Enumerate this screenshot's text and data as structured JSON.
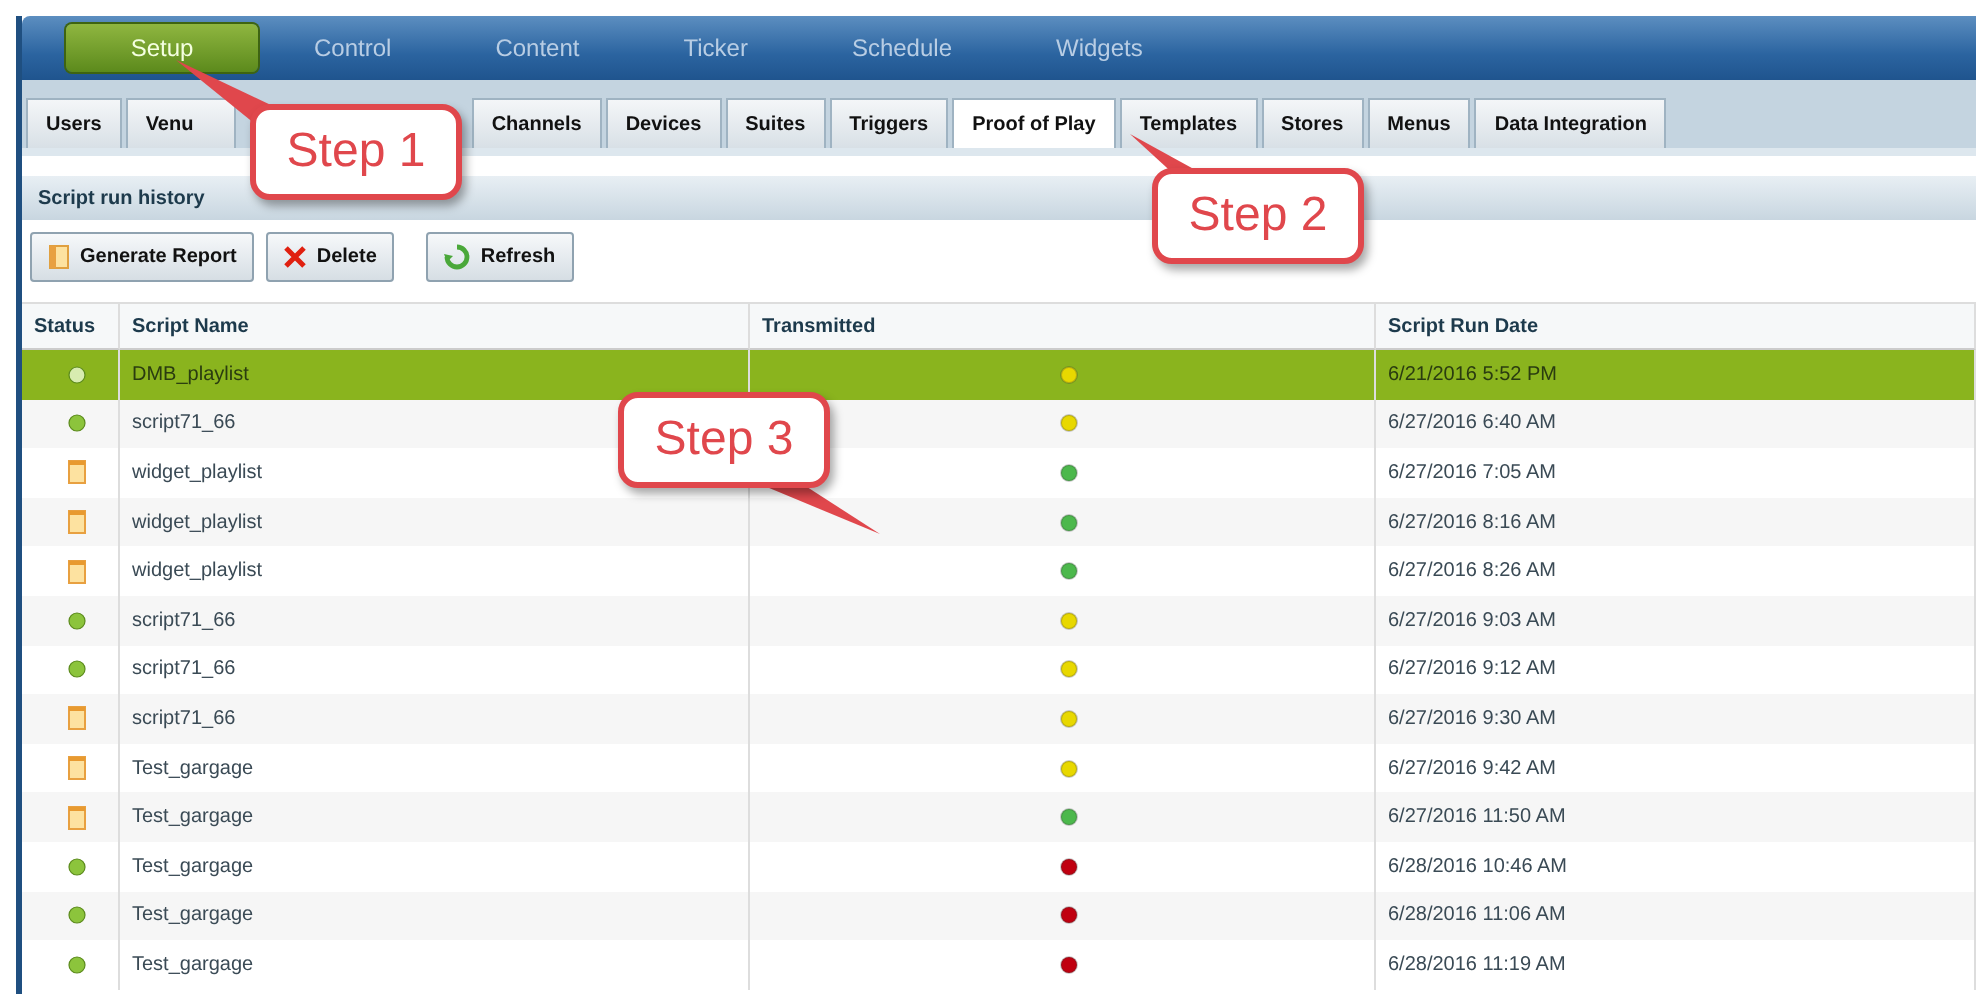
{
  "nav": [
    {
      "label": "Setup",
      "selected": true
    },
    {
      "label": "Control",
      "selected": false
    },
    {
      "label": "Content",
      "selected": false
    },
    {
      "label": "Ticker",
      "selected": false
    },
    {
      "label": "Schedule",
      "selected": false
    },
    {
      "label": "Widgets",
      "selected": false
    }
  ],
  "tabs": [
    {
      "label": "Users",
      "selected": false
    },
    {
      "label": "Venu",
      "selected": false
    },
    {
      "label": "Channels",
      "selected": false
    },
    {
      "label": "Devices",
      "selected": false
    },
    {
      "label": "Suites",
      "selected": false
    },
    {
      "label": "Triggers",
      "selected": false
    },
    {
      "label": "Proof of Play",
      "selected": true
    },
    {
      "label": "Templates",
      "selected": false
    },
    {
      "label": "Stores",
      "selected": false
    },
    {
      "label": "Menus",
      "selected": false
    },
    {
      "label": "Data Integration",
      "selected": false
    }
  ],
  "section_title": "Script run history",
  "toolbar": [
    {
      "label": "Generate Report",
      "kind": "report"
    },
    {
      "label": "Delete",
      "kind": "delete"
    },
    {
      "label": "Refresh",
      "kind": "refresh"
    }
  ],
  "table": {
    "columns": [
      "Status",
      "Script Name",
      "Transmitted",
      "Script Run Date"
    ],
    "rows": [
      {
        "kind": "dot",
        "name": "DMB_playlist",
        "transmitted": {
          "color": "#e8d800"
        },
        "date": "6/21/2016 5:52 PM",
        "selected": true
      },
      {
        "kind": "dot",
        "name": "script71_66",
        "transmitted": {
          "color": "#e8d800"
        },
        "date": "6/27/2016 6:40 AM",
        "selected": false
      },
      {
        "kind": "file",
        "name": "widget_playlist",
        "transmitted": {
          "color": "#4cb84c"
        },
        "date": "6/27/2016 7:05 AM",
        "selected": false
      },
      {
        "kind": "file",
        "name": "widget_playlist",
        "transmitted": {
          "color": "#4cb84c"
        },
        "date": "6/27/2016 8:16 AM",
        "selected": false
      },
      {
        "kind": "file",
        "name": "widget_playlist",
        "transmitted": {
          "color": "#4cb84c"
        },
        "date": "6/27/2016 8:26 AM",
        "selected": false
      },
      {
        "kind": "dot",
        "name": "script71_66",
        "transmitted": {
          "color": "#e8d800"
        },
        "date": "6/27/2016 9:03 AM",
        "selected": false
      },
      {
        "kind": "dot",
        "name": "script71_66",
        "transmitted": {
          "color": "#e8d800"
        },
        "date": "6/27/2016 9:12 AM",
        "selected": false
      },
      {
        "kind": "file",
        "name": "script71_66",
        "transmitted": {
          "color": "#e8d800"
        },
        "date": "6/27/2016 9:30 AM",
        "selected": false
      },
      {
        "kind": "file",
        "name": "Test_gargage",
        "transmitted": {
          "color": "#e8d800"
        },
        "date": "6/27/2016 9:42 AM",
        "selected": false
      },
      {
        "kind": "file",
        "name": "Test_gargage",
        "transmitted": {
          "color": "#4cb84c"
        },
        "date": "6/27/2016 11:50 AM",
        "selected": false
      },
      {
        "kind": "dot",
        "name": "Test_gargage",
        "transmitted": {
          "color": "#c00010"
        },
        "date": "6/28/2016 10:46 AM",
        "selected": false
      },
      {
        "kind": "dot",
        "name": "Test_gargage",
        "transmitted": {
          "color": "#c00010"
        },
        "date": "6/28/2016 11:06 AM",
        "selected": false
      },
      {
        "kind": "dot",
        "name": "Test_gargage",
        "transmitted": {
          "color": "#c00010"
        },
        "date": "6/28/2016 11:19 AM",
        "selected": false
      }
    ]
  },
  "callouts": [
    {
      "text": "Step 1"
    },
    {
      "text": "Step 2"
    },
    {
      "text": "Step 3"
    }
  ]
}
